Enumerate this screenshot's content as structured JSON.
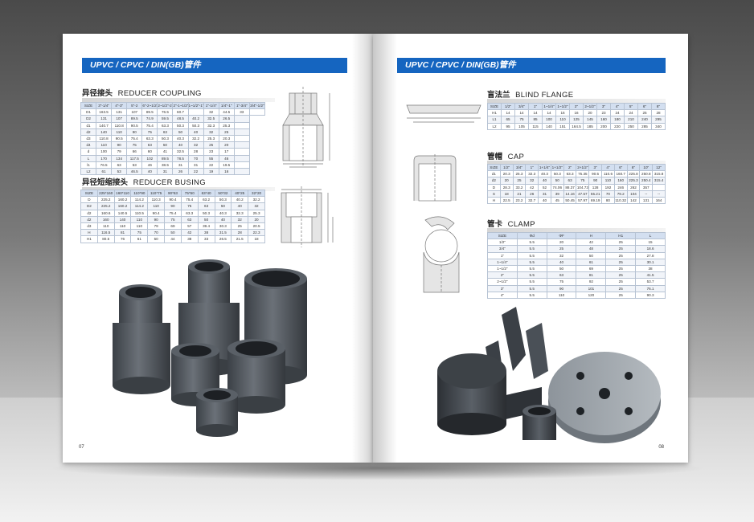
{
  "left_page": {
    "banner": "UPVC / CPVC / DIN(GB)管件",
    "page_number": "07",
    "reducer_coupling": {
      "title_cn": "异径接头",
      "title_en": "REDUCER COUPLING",
      "header": [
        "SIZE",
        "3\"-1/4\"",
        "4\"-3\"",
        "5\"-2",
        "6\"-2~1/2\"",
        "2~1/2\"-2\"",
        "2\"-1~1/2\"",
        "1~1/2\"-1\"",
        "1\"-1/4\"",
        "1/4\"-1\"",
        "1\"-3/4\"",
        "3/4\"-1/2\""
      ],
      "rows": [
        [
          "D1",
          "163.5",
          "131",
          "107",
          "89.5",
          "76.5",
          "60.7",
          "",
          "32",
          "44.5",
          "33",
          ""
        ],
        [
          "D2",
          "131",
          "107",
          "89.5",
          "74.9",
          "59.5",
          "48.5",
          "40.2",
          "32.5",
          "26.5",
          ""
        ],
        [
          "d1",
          "140.7",
          "110.8",
          "90.5",
          "75.4",
          "63.3",
          "50.3",
          "50.3",
          "32.3",
          "25.3",
          ""
        ],
        [
          "d2",
          "140",
          "110",
          "90",
          "75",
          "63",
          "50",
          "40",
          "32",
          "25",
          ""
        ],
        [
          "d3",
          "110.8",
          "90.5",
          "75.4",
          "63.3",
          "50.3",
          "40.3",
          "32.2",
          "25.3",
          "20.3",
          ""
        ],
        [
          "d4",
          "110",
          "90",
          "75",
          "63",
          "50",
          "40",
          "32",
          "25",
          "20",
          ""
        ],
        [
          "d",
          "100",
          "79",
          "66",
          "60",
          "41",
          "32.5",
          "28",
          "23",
          "17",
          ""
        ],
        [
          "L",
          "170",
          "134",
          "117.5",
          "102",
          "89.5",
          "78.5",
          "70",
          "55",
          "46",
          ""
        ],
        [
          "l1",
          "76.5",
          "63",
          "53",
          "46",
          "38.5",
          "31",
          "31",
          "22",
          "19.5",
          ""
        ],
        [
          "L2",
          "61",
          "53",
          "46.5",
          "40",
          "31",
          "26",
          "22",
          "19",
          "16",
          ""
        ]
      ]
    },
    "reducer_busing": {
      "title_cn": "异径短缩接头",
      "title_en": "REDUCER BUSING",
      "header": [
        "SIZE",
        "225*160",
        "160*110",
        "110*90",
        "110*75",
        "90*63",
        "75*50",
        "63*40",
        "50*32",
        "40*25",
        "32*20"
      ],
      "rows": [
        [
          "D",
          "225.2",
          "160.2",
          "114.2",
          "110.3",
          "90.4",
          "75.4",
          "63.2",
          "50.3",
          "40.2",
          "32.2"
        ],
        [
          "D2",
          "225.2",
          "160.2",
          "114.2",
          "110",
          "90",
          "75",
          "63",
          "50",
          "40",
          "32"
        ],
        [
          "d2",
          "160.6",
          "140.5",
          "110.5",
          "90.4",
          "75.4",
          "63.3",
          "50.3",
          "40.3",
          "32.3",
          "25.3"
        ],
        [
          "d2",
          "160",
          "140",
          "110",
          "90",
          "75",
          "63",
          "50",
          "40",
          "32",
          "20"
        ],
        [
          "d3",
          "110",
          "110",
          "110",
          "79",
          "69",
          "57",
          "39.4",
          "30.3",
          "25",
          "20.5"
        ],
        [
          "H",
          "116.5",
          "81",
          "75",
          "70",
          "50",
          "42",
          "38",
          "31.5",
          "28",
          "22.3"
        ],
        [
          "H1",
          "80.5",
          "76",
          "61",
          "50",
          "44",
          "38",
          "33",
          "26.5",
          "21.5",
          "18"
        ]
      ]
    }
  },
  "right_page": {
    "banner": "UPVC / CPVC / DIN(GB)管件",
    "page_number": "08",
    "blind_flange": {
      "title_cn": "盲法兰",
      "title_en": "BLIND FLANGE",
      "header": [
        "SIZE",
        "1/2\"",
        "3/4\"",
        "1\"",
        "1~1/4\"",
        "1~1/2\"",
        "2\"",
        "2~1/2\"",
        "3\"",
        "4\"",
        "5\"",
        "6\"",
        "8\""
      ],
      "rows": [
        [
          "H1",
          "14",
          "14",
          "14",
          "14",
          "16",
          "16",
          "20",
          "23",
          "24",
          "24",
          "25",
          "28"
        ],
        [
          "L1",
          "65",
          "75",
          "85",
          "100",
          "110",
          "125",
          "145",
          "160",
          "180",
          "210",
          "240",
          "295"
        ],
        [
          "L2",
          "95",
          "105",
          "115",
          "140",
          "151",
          "164.5",
          "185",
          "200",
          "220",
          "250",
          "285",
          "340"
        ]
      ]
    },
    "cap": {
      "title_cn": "管帽",
      "title_en": "CAP",
      "header": [
        "SIZE",
        "1/2\"",
        "3/4\"",
        "1\"",
        "1+1/4\"",
        "1+1/2\"",
        "2\"",
        "2+1/2\"",
        "3\"",
        "4\"",
        "6\"",
        "8\"",
        "10\"",
        "12\""
      ],
      "rows": [
        [
          "d1",
          "20.3",
          "25.3",
          "32.3",
          "40.3",
          "50.3",
          "63.3",
          "75.35",
          "90.5",
          "110.6",
          "160.7",
          "225.8",
          "250.8",
          "315.8"
        ],
        [
          "d2",
          "20",
          "25",
          "32",
          "40",
          "50",
          "63",
          "75",
          "90",
          "110",
          "160",
          "225.3",
          "250.4",
          "315.4"
        ],
        [
          "D",
          "28.3",
          "33.2",
          "42",
          "52",
          "74.06",
          "88.37",
          "104.73",
          "128",
          "192",
          "246",
          "262",
          "357",
          ""
        ],
        [
          "S",
          "18",
          "21",
          "26",
          "31",
          "39",
          "14.16",
          "47.57",
          "55.21",
          "70",
          "79.2",
          "104",
          "--",
          "--"
        ],
        [
          "H",
          "22.5",
          "23.2",
          "32.7",
          "40",
          "45",
          "50.45",
          "57.97",
          "69.19",
          "80",
          "110.32",
          "142",
          "131",
          "164"
        ]
      ]
    },
    "clamp": {
      "title_cn": "管卡",
      "title_en": "CLAMP",
      "header": [
        "SIZE",
        "Φd",
        "ΦF",
        "H",
        "H1",
        "L"
      ],
      "rows": [
        [
          "1/2\"",
          "5.5",
          "20",
          "42",
          "25",
          "15"
        ],
        [
          "3/4\"",
          "5.5",
          "25",
          "48",
          "25",
          "18.6"
        ],
        [
          "1\"",
          "5.5",
          "32",
          "50",
          "25",
          "27.8"
        ],
        [
          "1~1/4\"",
          "5.5",
          "40",
          "61",
          "25",
          "30.1"
        ],
        [
          "1~1/2\"",
          "5.5",
          "50",
          "69",
          "25",
          "38"
        ],
        [
          "2\"",
          "5.5",
          "63",
          "81",
          "25",
          "41.5"
        ],
        [
          "2~1/2\"",
          "5.5",
          "75",
          "92",
          "25",
          "53.7"
        ],
        [
          "3\"",
          "5.5",
          "90",
          "101",
          "25",
          "76.1"
        ],
        [
          "4\"",
          "5.5",
          "110",
          "120",
          "25",
          "90.3"
        ]
      ]
    }
  },
  "colors": {
    "banner_blue": "#1565c0",
    "pvc_gray": "#4b5158",
    "table_header": "#d3dff0"
  }
}
